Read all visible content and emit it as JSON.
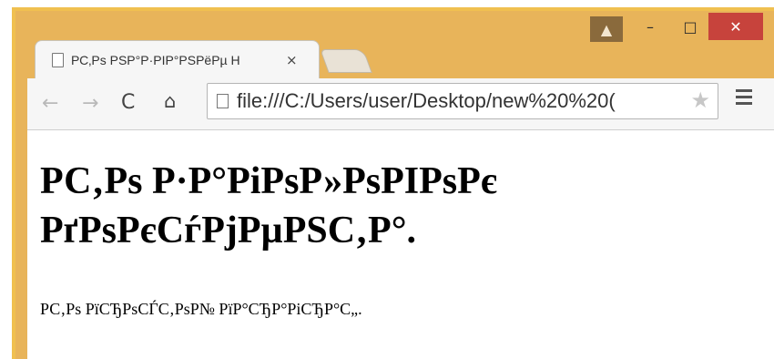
{
  "window": {
    "controls": {
      "user": "▲",
      "minimize": "–",
      "maximize": "□",
      "close": "✕"
    }
  },
  "tabs": [
    {
      "title": "РС‚Рѕ РЅР°Р·РІР°РЅРёРµ Н",
      "close": "×",
      "active": true
    }
  ],
  "toolbar": {
    "back_icon": "←",
    "forward_icon": "→",
    "reload_icon": "C",
    "home_icon": "⌂",
    "url": "file:///C:/Users/user/Desktop/new%20%20(",
    "star_icon": "★"
  },
  "content": {
    "heading": "РС‚Рѕ Р·Р°РіРѕР»РѕРІРѕРє РґРѕРєСѓРјРµРЅС‚Р°.",
    "paragraph": "РС‚Рѕ РїСЂРѕСЃС‚РѕР№ РїР°СЂР°РіСЂР°С„."
  },
  "colors": {
    "frame": "#f0c050",
    "close_button": "#c7433c",
    "user_button": "#8a6a3c"
  }
}
